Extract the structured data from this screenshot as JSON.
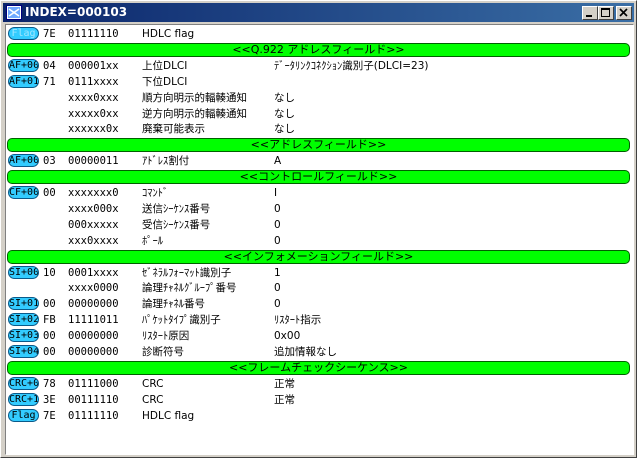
{
  "window": {
    "title": "INDEX=000103"
  },
  "rows": [
    {
      "kind": "field",
      "tag": "Flag",
      "tag_dim": true,
      "hex": "7E",
      "bits": "01111110",
      "desc": "HDLC flag",
      "value": ""
    },
    {
      "kind": "section",
      "label": "<<Q.922 アドレスフィールド>>"
    },
    {
      "kind": "field",
      "tag": "AF+00",
      "hex": "04",
      "bits": "000001xx",
      "desc": "上位DLCI",
      "value": "ﾃﾞｰﾀﾘﾝｸｺﾈｸｼｮﾝ識別子(DLCI=23)"
    },
    {
      "kind": "field",
      "tag": "AF+01",
      "hex": "71",
      "bits": "0111xxxx",
      "desc": "下位DLCI",
      "value": ""
    },
    {
      "kind": "field",
      "tag": "",
      "hex": "",
      "bits": "xxxx0xxx",
      "desc": "順方向明示的輻輳通知",
      "value": "なし"
    },
    {
      "kind": "field",
      "tag": "",
      "hex": "",
      "bits": "xxxxx0xx",
      "desc": "逆方向明示的輻輳通知",
      "value": "なし"
    },
    {
      "kind": "field",
      "tag": "",
      "hex": "",
      "bits": "xxxxxx0x",
      "desc": "廃棄可能表示",
      "value": "なし"
    },
    {
      "kind": "section",
      "label": "<<アドレスフィールド>>"
    },
    {
      "kind": "field",
      "tag": "AF+00",
      "hex": "03",
      "bits": "00000011",
      "desc": "ｱﾄﾞﾚｽ割付",
      "value": "A"
    },
    {
      "kind": "section",
      "label": "<<コントロールフィールド>>"
    },
    {
      "kind": "field",
      "tag": "CF+00",
      "hex": "00",
      "bits": "xxxxxxx0",
      "desc": "ｺﾏﾝﾄﾞ",
      "value": "I"
    },
    {
      "kind": "field",
      "tag": "",
      "hex": "",
      "bits": "xxxx000x",
      "desc": "送信ｼｰｹﾝｽ番号",
      "value": "0"
    },
    {
      "kind": "field",
      "tag": "",
      "hex": "",
      "bits": "000xxxxx",
      "desc": "受信ｼｰｹﾝｽ番号",
      "value": "0"
    },
    {
      "kind": "field",
      "tag": "",
      "hex": "",
      "bits": "xxx0xxxx",
      "desc": "ﾎﾟｰﾙ",
      "value": "0"
    },
    {
      "kind": "section",
      "label": "<<インフォメーションフィールド>>"
    },
    {
      "kind": "field",
      "tag": "SI+00",
      "hex": "10",
      "bits": "0001xxxx",
      "desc": "ｾﾞﾈﾗﾙﾌｫｰﾏｯﾄ識別子",
      "value": "1"
    },
    {
      "kind": "field",
      "tag": "",
      "hex": "",
      "bits": "xxxx0000",
      "desc": "論理ﾁｬﾈﾙｸﾞﾙｰﾌﾟ番号",
      "value": "0"
    },
    {
      "kind": "field",
      "tag": "SI+01",
      "hex": "00",
      "bits": "00000000",
      "desc": "論理ﾁｬﾈﾙ番号",
      "value": "0"
    },
    {
      "kind": "field",
      "tag": "SI+02",
      "hex": "FB",
      "bits": "11111011",
      "desc": "ﾊﾟｹｯﾄﾀｲﾌﾟ識別子",
      "value": "ﾘｽﾀｰﾄ指示"
    },
    {
      "kind": "field",
      "tag": "SI+03",
      "hex": "00",
      "bits": "00000000",
      "desc": "ﾘｽﾀｰﾄ原因",
      "value": "0x00"
    },
    {
      "kind": "field",
      "tag": "SI+04",
      "hex": "00",
      "bits": "00000000",
      "desc": "診断符号",
      "value": "追加情報なし"
    },
    {
      "kind": "section",
      "label": "<<フレームチェックシーケンス>>"
    },
    {
      "kind": "field",
      "tag": "CRC+0",
      "hex": "78",
      "bits": "01111000",
      "desc": "CRC",
      "value": "正常"
    },
    {
      "kind": "field",
      "tag": "CRC+1",
      "hex": "3E",
      "bits": "00111110",
      "desc": "CRC",
      "value": "正常"
    },
    {
      "kind": "field",
      "tag": "Flag",
      "hex": "7E",
      "bits": "01111110",
      "desc": "HDLC flag",
      "value": ""
    }
  ]
}
